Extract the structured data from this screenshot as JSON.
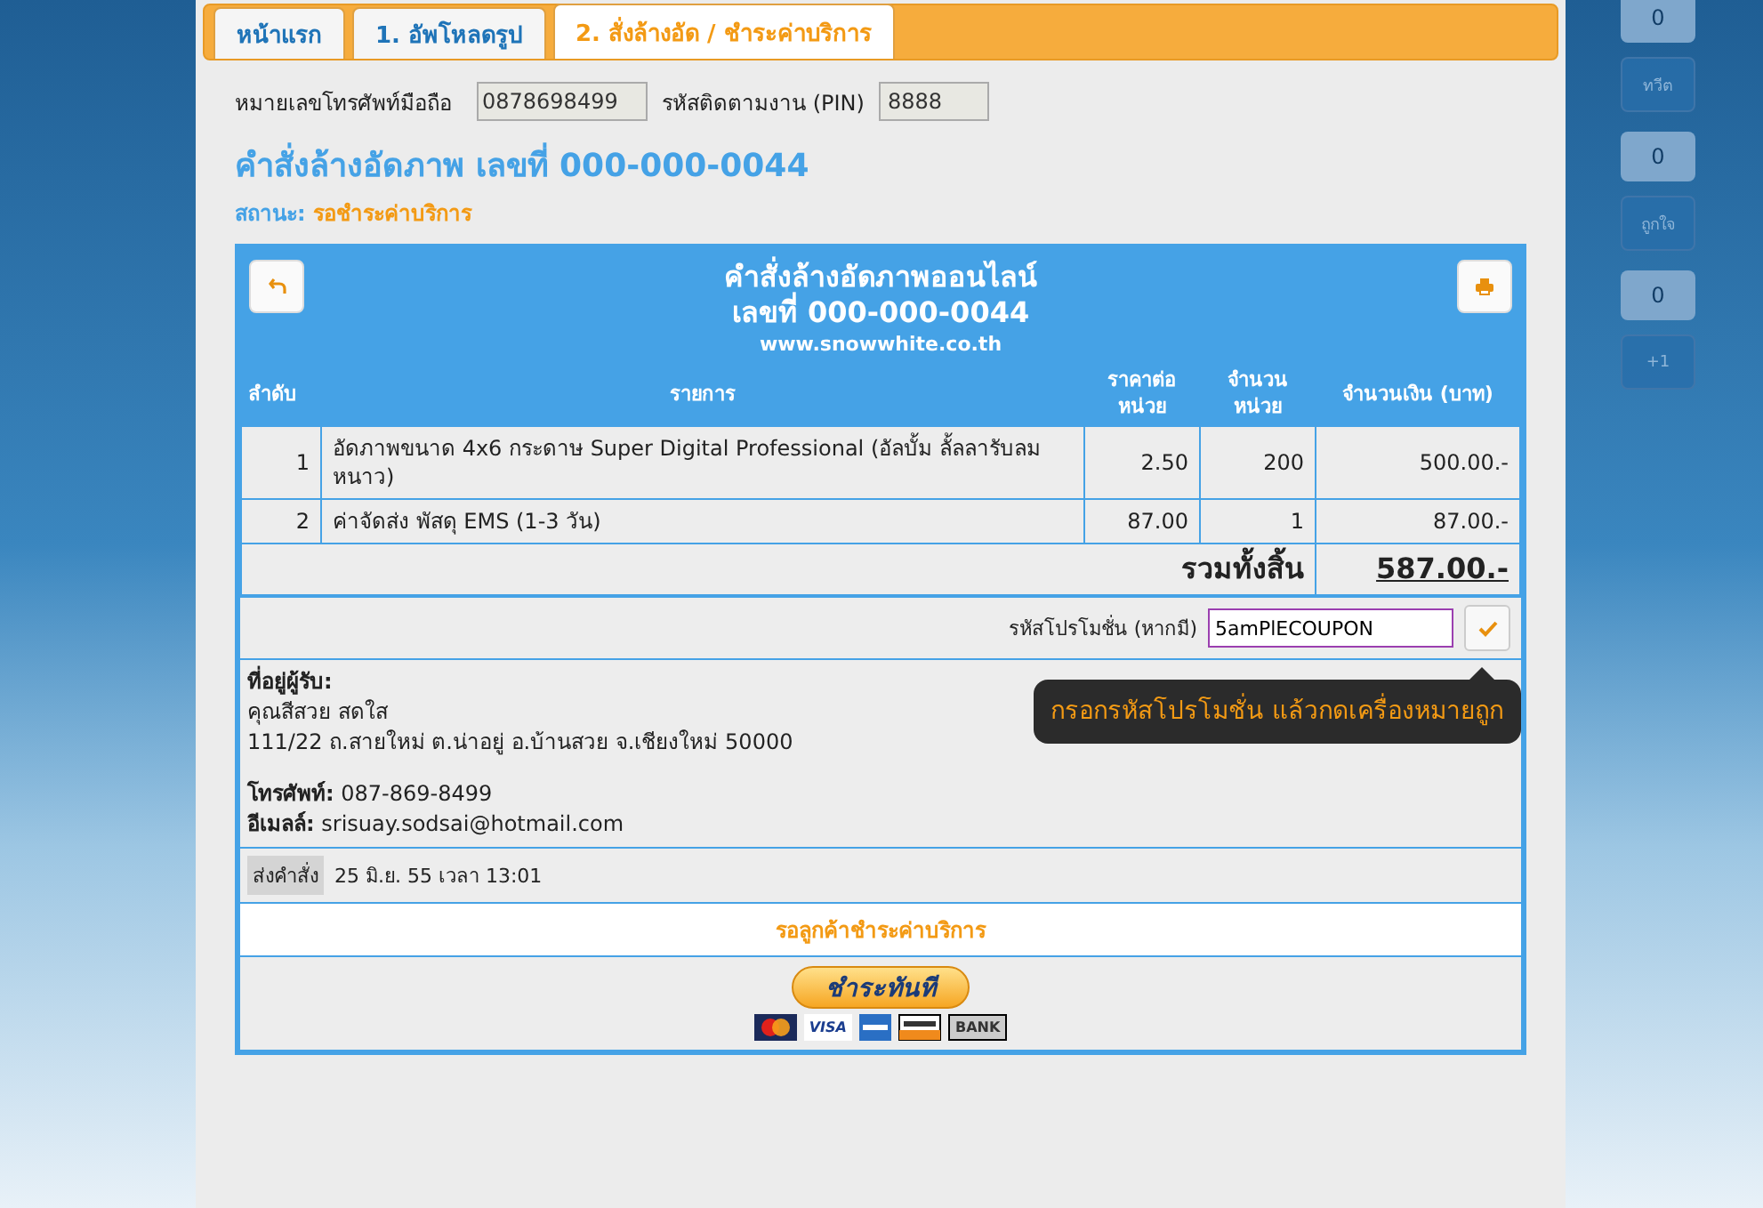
{
  "tabs": [
    {
      "label": "หน้าแรก",
      "selected": false
    },
    {
      "label": "1. อัพโหลดรูป",
      "selected": false
    },
    {
      "label": "2. สั่งล้างอัด / ชำระค่าบริการ",
      "selected": true
    }
  ],
  "lookup": {
    "phone_label": "หมายเลขโทรศัพท์มือถือ",
    "phone_value": "0878698499",
    "pin_label": "รหัสติดตามงาน (PIN)",
    "pin_value": "8888"
  },
  "order_heading": {
    "title": "คำสั่งล้างอัดภาพ เลขที่ 000-000-0044",
    "status_label": "สถานะ:",
    "status_value": "รอชำระค่าบริการ"
  },
  "receipt": {
    "title": "คำสั่งล้างอัดภาพออนไลน์",
    "number": "เลขที่ 000-000-0044",
    "website": "www.snowwhite.co.th",
    "columns": [
      "ลำดับ",
      "รายการ",
      "ราคาต่อ หน่วย",
      "จำนวน หน่วย",
      "จำนวนเงิน (บาท)"
    ],
    "rows": [
      {
        "index": "1",
        "item": "อัดภาพขนาด 4x6 กระดาษ Super Digital Professional (อัลบั้ม ลั้ลลารับลมหนาว)",
        "price": "2.50",
        "qty": "200",
        "amount": "500.00.-"
      },
      {
        "index": "2",
        "item": "ค่าจัดส่ง พัสดุ EMS (1-3 วัน)",
        "price": "87.00",
        "qty": "1",
        "amount": "87.00.-"
      }
    ],
    "total_label": "รวมทั้งสิ้น",
    "total_value": "587.00.-",
    "promo": {
      "label": "รหัสโปรโมชั่น (หากมี)",
      "value": "5amPlECOUPON",
      "tooltip": "กรอกรหัสโปรโมชั่น แล้วกดเครื่องหมายถูก"
    },
    "address": {
      "heading": "ที่อยู่ผู้รับ:",
      "name": "คุณสีสวย สดใส",
      "line": "111/22 ถ.สายใหม่ ต.น่าอยู่ อ.บ้านสวย จ.เชียงใหม่ 50000",
      "phone_label": "โทรศัพท์:",
      "phone": "087-869-8499",
      "email_label": "อีเมลล์:",
      "email": "srisuay.sodsai@hotmail.com"
    },
    "ordered_label": "ส่งคำสั่ง",
    "ordered_time": "25 มิ.ย. 55 เวลา 13:01",
    "waiting": "รอลูกค้าชำระค่าบริการ",
    "pay_button": "ชำระทันที",
    "cards": [
      "VISA",
      "BANK"
    ]
  },
  "social": [
    {
      "count": "0",
      "label": "ทวีต"
    },
    {
      "count": "0",
      "label": "ถูกใจ"
    },
    {
      "count": "0",
      "label": "+1"
    }
  ]
}
